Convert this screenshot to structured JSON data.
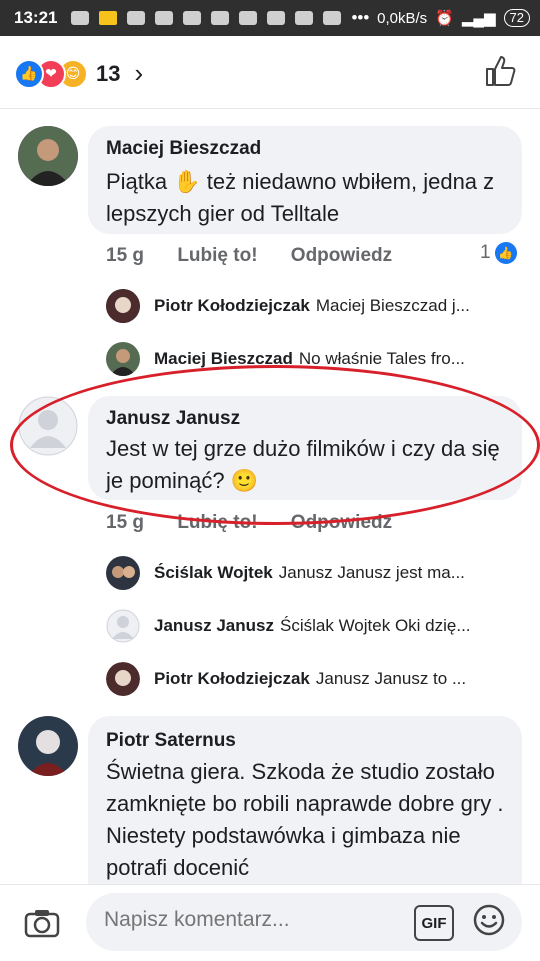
{
  "status": {
    "time": "13:21",
    "net": "0,0kB/s",
    "battery": "72"
  },
  "header": {
    "reaction_count": "13",
    "chevron": "›"
  },
  "comments": [
    {
      "author": "Maciej Bieszczad",
      "text": "Piątka ✋ też niedawno wbiłem, jedna z lepszych gier od Telltale",
      "time": "15 g",
      "like": "Lubię to!",
      "reply": "Odpowiedz",
      "likes": "1"
    },
    {
      "author": "Janusz Janusz",
      "text": "Jest w tej grze dużo filmików i czy da się je pominąć? 🙂",
      "time": "15 g",
      "like": "Lubię to!",
      "reply": "Odpowiedz"
    },
    {
      "author": "Piotr Saternus",
      "text": "Świetna giera. Szkoda że studio zostało zamknięte bo robili naprawde dobre gry . Niestety podstawówka i gimbaza nie potrafi docenić"
    }
  ],
  "replies": [
    {
      "name": "Piotr Kołodziejczak",
      "preview": "Maciej Bieszczad j..."
    },
    {
      "name": "Maciej Bieszczad",
      "preview": "No właśnie Tales fro..."
    },
    {
      "name": "Ściślak Wojtek",
      "preview": "Janusz Janusz jest ma..."
    },
    {
      "name": "Janusz Janusz",
      "preview": "Ściślak Wojtek Oki dzię..."
    },
    {
      "name": "Piotr Kołodziejczak",
      "preview": "Janusz Janusz to ..."
    }
  ],
  "composer": {
    "placeholder": "Napisz komentarz...",
    "gif": "GIF"
  }
}
